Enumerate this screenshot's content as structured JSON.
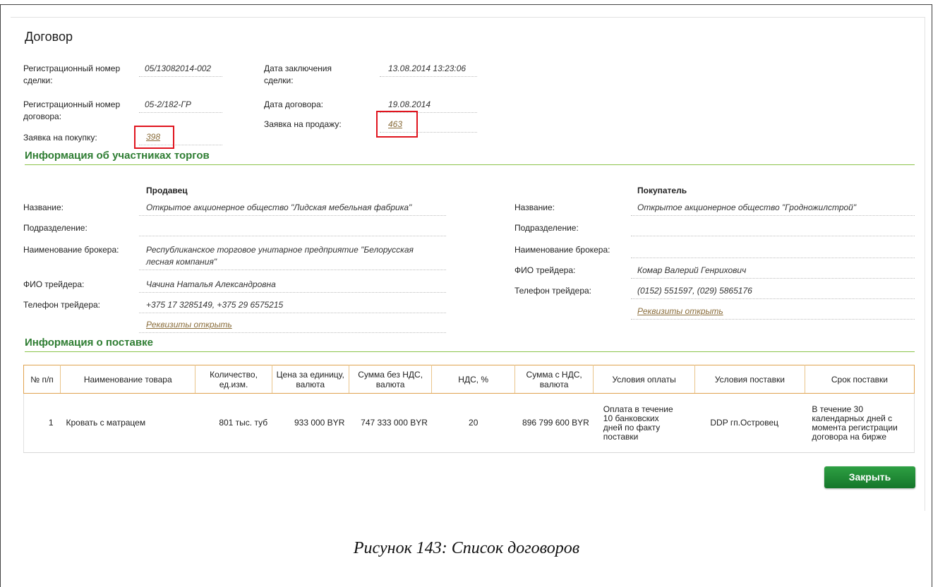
{
  "page": {
    "title": "Договор",
    "caption": "Рисунок 143: Список договоров",
    "close_button": "Закрыть"
  },
  "deal": {
    "reg_number_label": "Регистрационный номер сделки:",
    "reg_number_value": "05/13082014-002",
    "contract_number_label": "Регистрационный номер договора:",
    "contract_number_value": "05-2/182-ГР",
    "buy_order_label": "Заявка на покупку:",
    "buy_order_value": "398",
    "conclusion_date_label": "Дата заключения сделки:",
    "conclusion_date_value": "13.08.2014 13:23:06",
    "contract_date_label": "Дата договора:",
    "contract_date_value": "19.08.2014",
    "sell_order_label": "Заявка на продажу:",
    "sell_order_value": "463"
  },
  "participants": {
    "section_title": "Информация об участниках торгов",
    "seller": {
      "heading": "Продавец",
      "name_label": "Название:",
      "name_value": "Открытое акционерное общество \"Лидская мебельная фабрика\"",
      "division_label": "Подразделение:",
      "division_value": "",
      "broker_label": "Наименование брокера:",
      "broker_value_line1": "Республиканское торговое унитарное предприятие \"Белорусская",
      "broker_value_line2": "лесная компания\"",
      "trader_label": "ФИО трейдера:",
      "trader_value": "Чачина Наталья Александровна",
      "phone_label": "Телефон трейдера:",
      "phone_value": "+375 17 3285149, +375 29 6575215",
      "requisites_link": "Реквизиты открыть"
    },
    "buyer": {
      "heading": "Покупатель",
      "name_label": "Название:",
      "name_value": "Открытое акционерное общество \"Гродножилстрой\"",
      "division_label": "Подразделение:",
      "division_value": "",
      "broker_label": "Наименование брокера:",
      "broker_value": "",
      "trader_label": "ФИО трейдера:",
      "trader_value": "Комар Валерий Генрихович",
      "phone_label": "Телефон трейдера:",
      "phone_value": "(0152) 551597, (029) 5865176",
      "requisites_link": "Реквизиты открыть"
    }
  },
  "delivery": {
    "section_title": "Информация о поставке",
    "columns": [
      "№ п/п",
      "Наименование товара",
      "Количество, ед.изм.",
      "Цена за единицу, валюта",
      "Сумма без НДС, валюта",
      "НДС, %",
      "Сумма с НДС, валюта",
      "Условия оплаты",
      "Условия поставки",
      "Срок поставки"
    ],
    "rows": [
      {
        "num": "1",
        "product": "Кровать с матрацем",
        "quantity": "801 тыс. туб",
        "unit_price": "933 000 BYR",
        "sum_no_vat": "747 333 000 BYR",
        "vat": "20",
        "sum_with_vat": "896 799 600 BYR",
        "payment_terms": "Оплата в течение 10 банковских дней по факту поставки",
        "delivery_terms": "DDP гп.Островец",
        "delivery_period": "В течение 30 календарных дней с момента регистрации договора на бирже"
      }
    ]
  },
  "colors": {
    "section_green": "#2e7d32",
    "link_brown": "#8a6d3b",
    "highlight_red": "#e0141e",
    "table_header_border": "#e0a350",
    "button_green": "#1f8a34"
  }
}
